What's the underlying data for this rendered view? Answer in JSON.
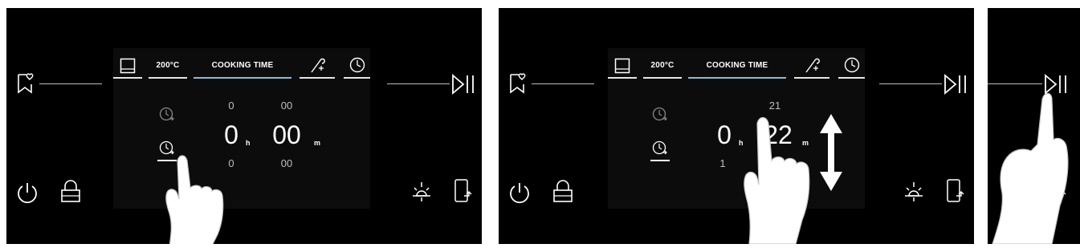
{
  "panel1": {
    "tabs": {
      "temp": "200°C",
      "cooking": "COOKING TIME"
    },
    "time": {
      "prev_hours": "0",
      "prev_minutes": "00",
      "hours": "0",
      "minutes": "00",
      "next_hours": "0",
      "next_minutes": "00",
      "hours_unit": "h",
      "minutes_unit": "m"
    }
  },
  "panel2": {
    "tabs": {
      "temp": "200°C",
      "cooking": "COOKING TIME"
    },
    "time": {
      "prev_minutes": "21",
      "hours": "0",
      "minutes": "22",
      "next_hours": "1",
      "hours_unit": "h",
      "minutes_unit": "m"
    }
  },
  "colors": {
    "background": "#000000",
    "active_tab_underline": "#8fb7d9",
    "line": "#bdbdbd"
  }
}
